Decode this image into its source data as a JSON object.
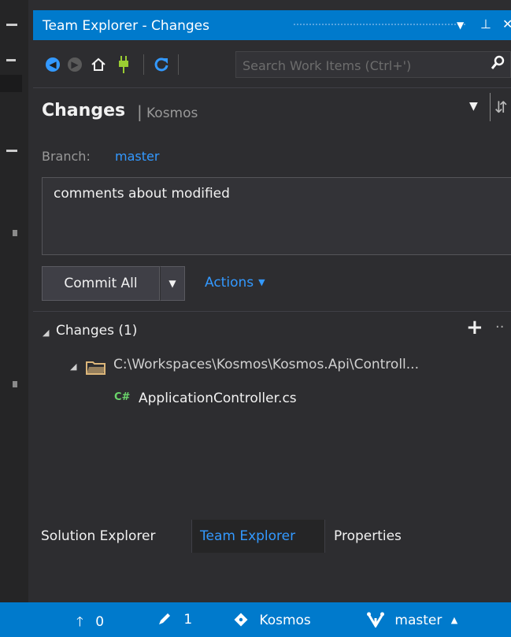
{
  "window": {
    "title": "Team Explorer - Changes"
  },
  "toolbar": {
    "search_placeholder": "Search Work Items (Ctrl+')",
    "icons": [
      "back-icon",
      "forward-icon",
      "home-icon",
      "connect-icon",
      "refresh-icon",
      "search-icon"
    ]
  },
  "header": {
    "title": "Changes",
    "separator": "|",
    "repo": "Kosmos"
  },
  "branch": {
    "label": "Branch:",
    "name": "master"
  },
  "commit": {
    "message": "comments about modified",
    "button_label": "Commit All",
    "actions_label": "Actions"
  },
  "changes": {
    "header": "Changes (1)",
    "folder_path": "C:\\Workspaces\\Kosmos\\Kosmos.Api\\Controll...",
    "file_lang_badge": "C#",
    "file_name": "ApplicationController.cs"
  },
  "tabs": [
    {
      "label": "Solution Explorer",
      "active": false
    },
    {
      "label": "Team Explorer",
      "active": true
    },
    {
      "label": "Properties",
      "active": false
    }
  ],
  "status_bar": {
    "outgoing": "0",
    "pending_edits": "1",
    "repo": "Kosmos",
    "branch": "master"
  },
  "colors": {
    "accent": "#007acc",
    "link": "#3399ff",
    "background": "#2d2d30"
  }
}
